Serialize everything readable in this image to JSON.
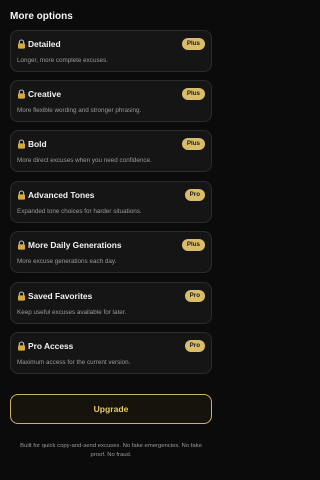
{
  "section_title": "More options",
  "options": [
    {
      "title": "Detailed",
      "desc": "Longer, more complete excuses.",
      "badge": "Plus"
    },
    {
      "title": "Creative",
      "desc": "More flexible wording and stronger phrasing.",
      "badge": "Plus"
    },
    {
      "title": "Bold",
      "desc": "More direct excuses when you need confidence.",
      "badge": "Plus"
    },
    {
      "title": "Advanced Tones",
      "desc": "Expanded tone choices for harder situations.",
      "badge": "Pro"
    },
    {
      "title": "More Daily Generations",
      "desc": "More excuse generations each day.",
      "badge": "Plus"
    },
    {
      "title": "Saved Favorites",
      "desc": "Keep useful excuses available for later.",
      "badge": "Pro"
    },
    {
      "title": "Pro Access",
      "desc": "Maximum access for the current version.",
      "badge": "Pro"
    }
  ],
  "icons": {
    "lock": "lock-icon"
  },
  "upgrade_label": "Upgrade",
  "footer_text": "Built for quick copy-and-send excuses. No fake emergencies. No fake proof. No fraud.",
  "colors": {
    "accent_gold": "#d9bd6a",
    "background": "#0b0b0b",
    "card": "#151515"
  }
}
